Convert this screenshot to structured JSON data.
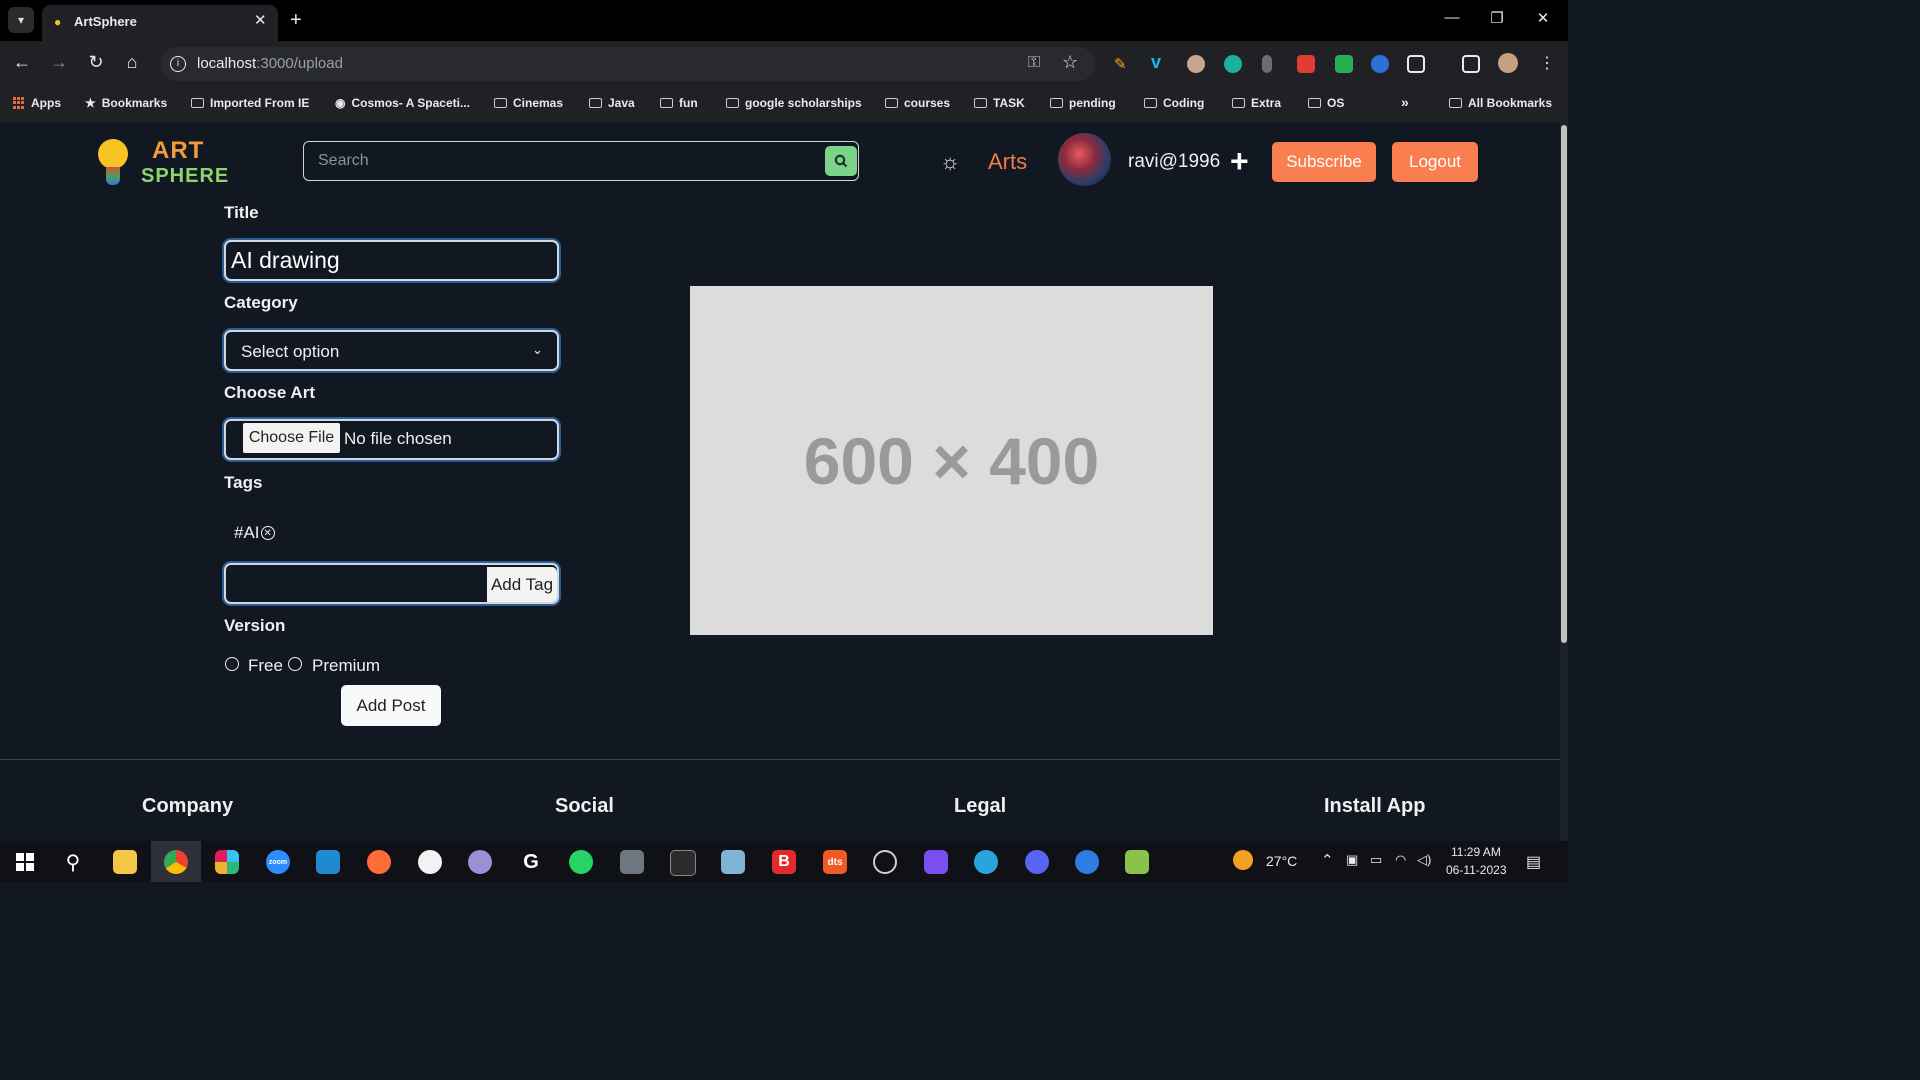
{
  "browser": {
    "tab_title": "ArtSphere",
    "url_host": "localhost",
    "url_path": ":3000/upload",
    "bookmarks": [
      "Apps",
      "Bookmarks",
      "Imported From IE",
      "Cosmos- A Spaceti...",
      "Cinemas",
      "Java",
      "fun",
      "google scholarships",
      "courses",
      "TASK",
      "pending",
      "Coding",
      "Extra",
      "OS"
    ],
    "all_bookmarks": "All Bookmarks",
    "overflow_glyph": "»"
  },
  "header": {
    "logo_line1": "ART",
    "logo_line2": "SPHERE",
    "search_placeholder": "Search",
    "arts_link": "Arts",
    "username": "ravi@1996",
    "subscribe_label": "Subscribe",
    "logout_label": "Logout"
  },
  "form": {
    "title_label": "Title",
    "title_value": "AI drawing",
    "category_label": "Category",
    "category_value": "Select option",
    "choose_art_label": "Choose Art",
    "choose_file_label": "Choose File",
    "no_file_text": "No file chosen",
    "tags_label": "Tags",
    "tags": [
      "#AI"
    ],
    "add_tag_label": "Add Tag",
    "version_label": "Version",
    "version_options": [
      "Free",
      "Premium"
    ],
    "submit_label": "Add Post"
  },
  "preview": {
    "text": "600 × 400"
  },
  "footer": {
    "headings": [
      "Company",
      "Social",
      "Legal",
      "Install App"
    ]
  },
  "taskbar": {
    "temperature": "27°C",
    "time": "11:29 AM",
    "date": "06-11-2023"
  }
}
